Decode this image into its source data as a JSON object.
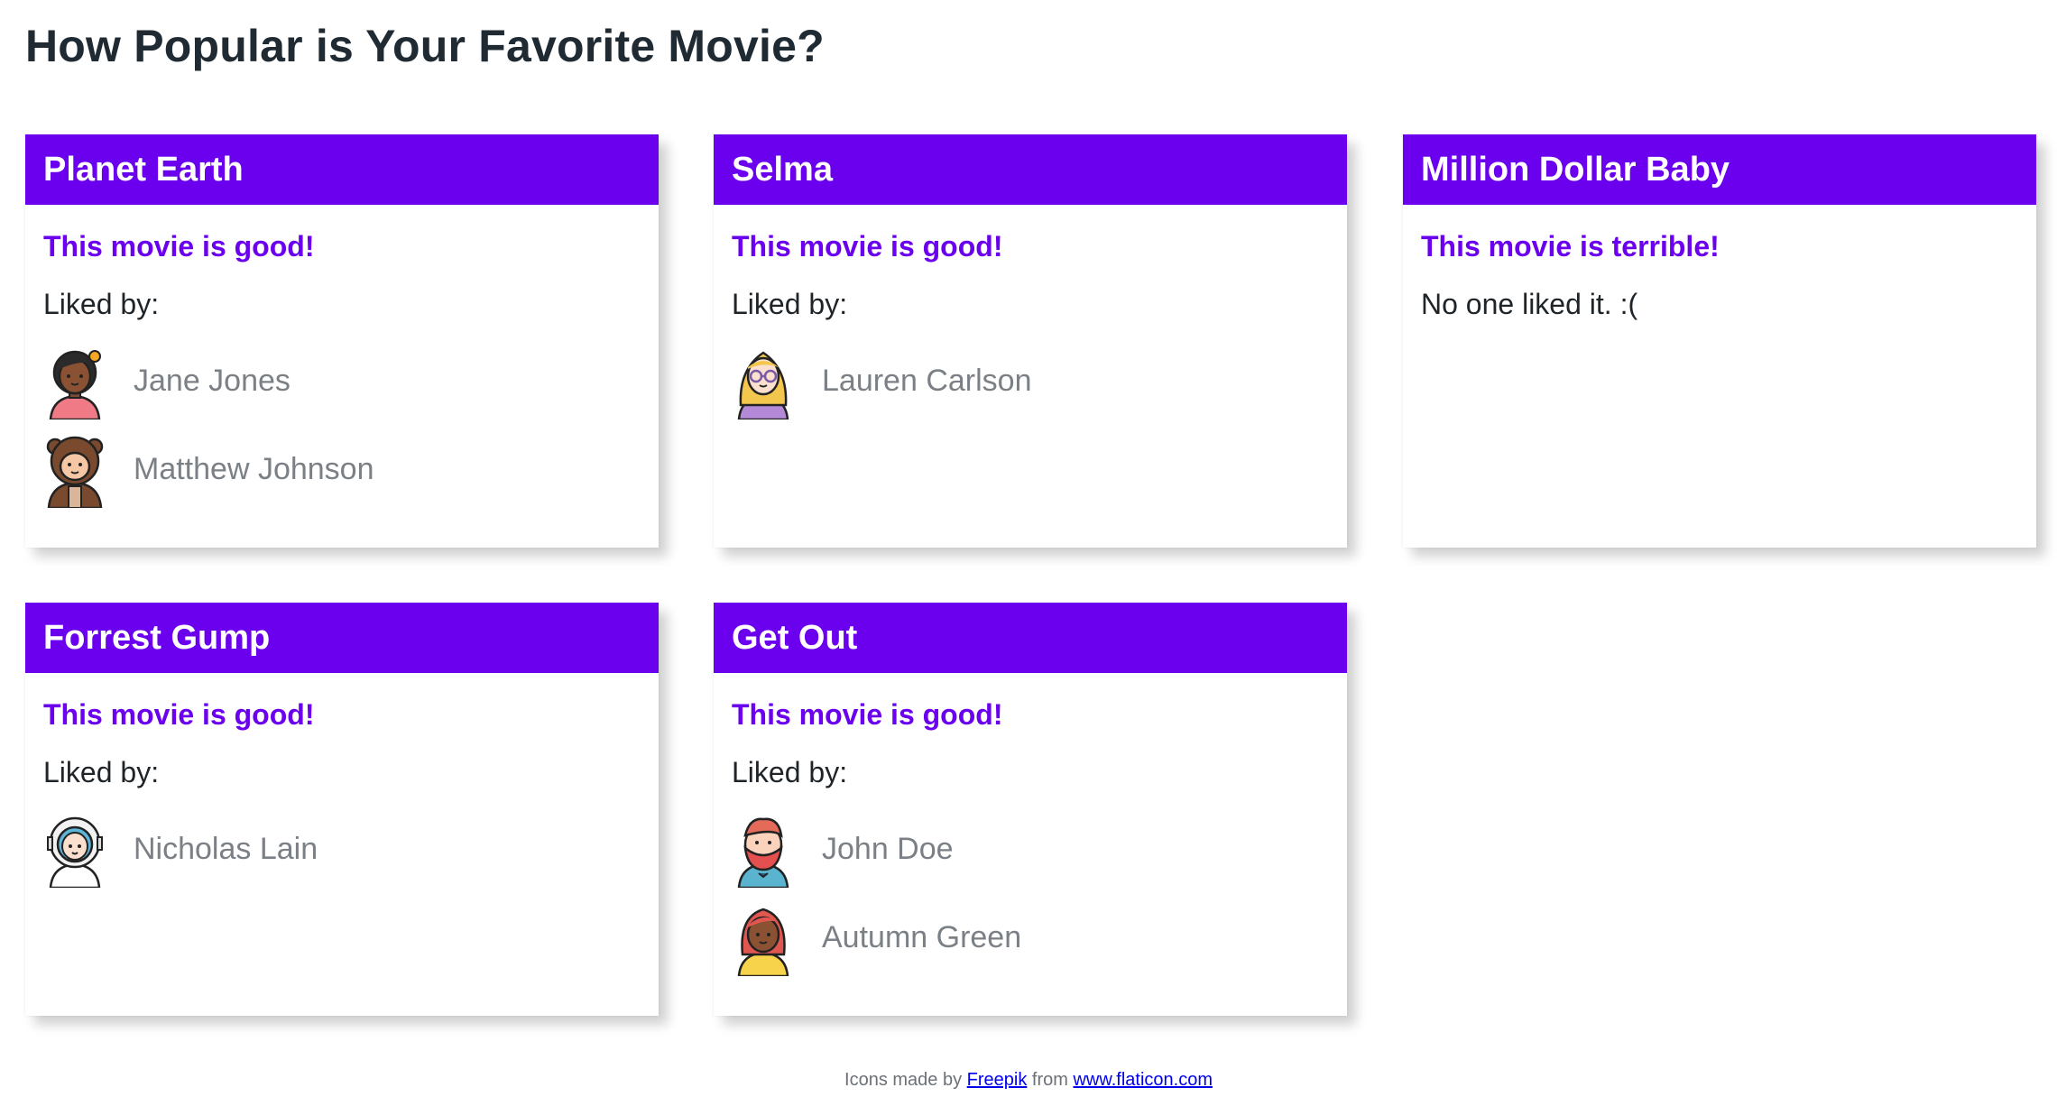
{
  "page": {
    "title": "How Popular is Your Favorite Movie?"
  },
  "movies": [
    {
      "title": "Planet Earth",
      "verdict": "This movie is good!",
      "liked_label": "Liked by:",
      "no_likes": "",
      "users": [
        {
          "name": "Jane Jones",
          "icon": "woman-avatar-icon"
        },
        {
          "name": "Matthew Johnson",
          "icon": "bear-costume-avatar-icon"
        }
      ]
    },
    {
      "title": "Selma",
      "verdict": "This movie is good!",
      "liked_label": "Liked by:",
      "no_likes": "",
      "users": [
        {
          "name": "Lauren Carlson",
          "icon": "blonde-glasses-avatar-icon"
        }
      ]
    },
    {
      "title": "Million Dollar Baby",
      "verdict": "This movie is terrible!",
      "liked_label": "",
      "no_likes": "No one liked it. :(",
      "users": []
    },
    {
      "title": "Forrest Gump",
      "verdict": "This movie is good!",
      "liked_label": "Liked by:",
      "no_likes": "",
      "users": [
        {
          "name": "Nicholas Lain",
          "icon": "astronaut-avatar-icon"
        }
      ]
    },
    {
      "title": "Get Out",
      "verdict": "This movie is good!",
      "liked_label": "Liked by:",
      "no_likes": "",
      "users": [
        {
          "name": "John Doe",
          "icon": "bearded-man-avatar-icon"
        },
        {
          "name": "Autumn Green",
          "icon": "woman-red-hair-avatar-icon"
        }
      ]
    }
  ],
  "footer": {
    "prefix": "Icons made by",
    "author_link": "Freepik",
    "middle": "from",
    "site_link": "www.flaticon.com"
  },
  "colors": {
    "accent": "#6a00ee",
    "heading": "#1f2a33",
    "muted": "#7a8085"
  }
}
